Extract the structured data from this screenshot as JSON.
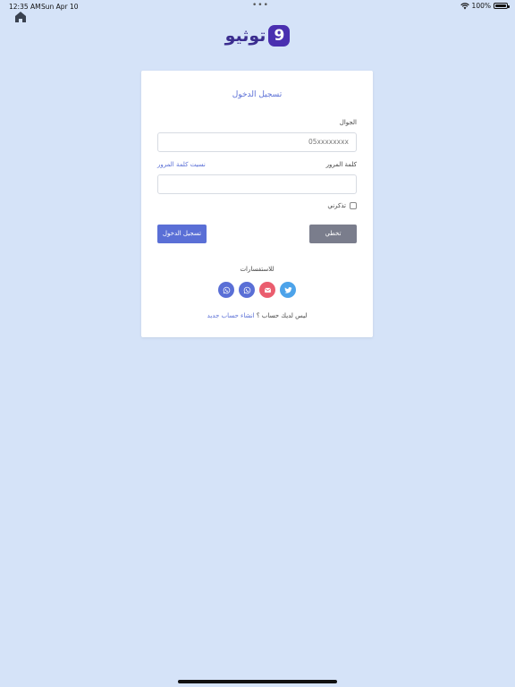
{
  "status": {
    "time": "12:35 AM",
    "date": "Sun Apr 10",
    "dots": "•••",
    "battery": "100%"
  },
  "logo": {
    "text": "توثيو",
    "mark": "9"
  },
  "login": {
    "title": "تسجيل الدخول",
    "phone_label": "الجوال",
    "phone_placeholder": "05xxxxxxxx",
    "password_label": "كلمة المرور",
    "forgot_label": "نسيت كلمة المرور",
    "remember_label": "تذكرني",
    "skip_label": "تخطي",
    "login_label": "تسجيل الدخول"
  },
  "inquiries": {
    "label": "للاستفسارات",
    "icons": [
      "twitter-icon",
      "mail-icon",
      "whatsapp-icon",
      "whatsapp-icon"
    ]
  },
  "signup": {
    "prompt": "ليس لديك حساب ؟",
    "link": "انشاء حساب جديد"
  },
  "colors": {
    "background": "#d5e3f8",
    "accent": "#5a6fd6",
    "skip": "#7a7d8c",
    "twitter": "#4da3ea",
    "mail": "#ea5d6e"
  }
}
